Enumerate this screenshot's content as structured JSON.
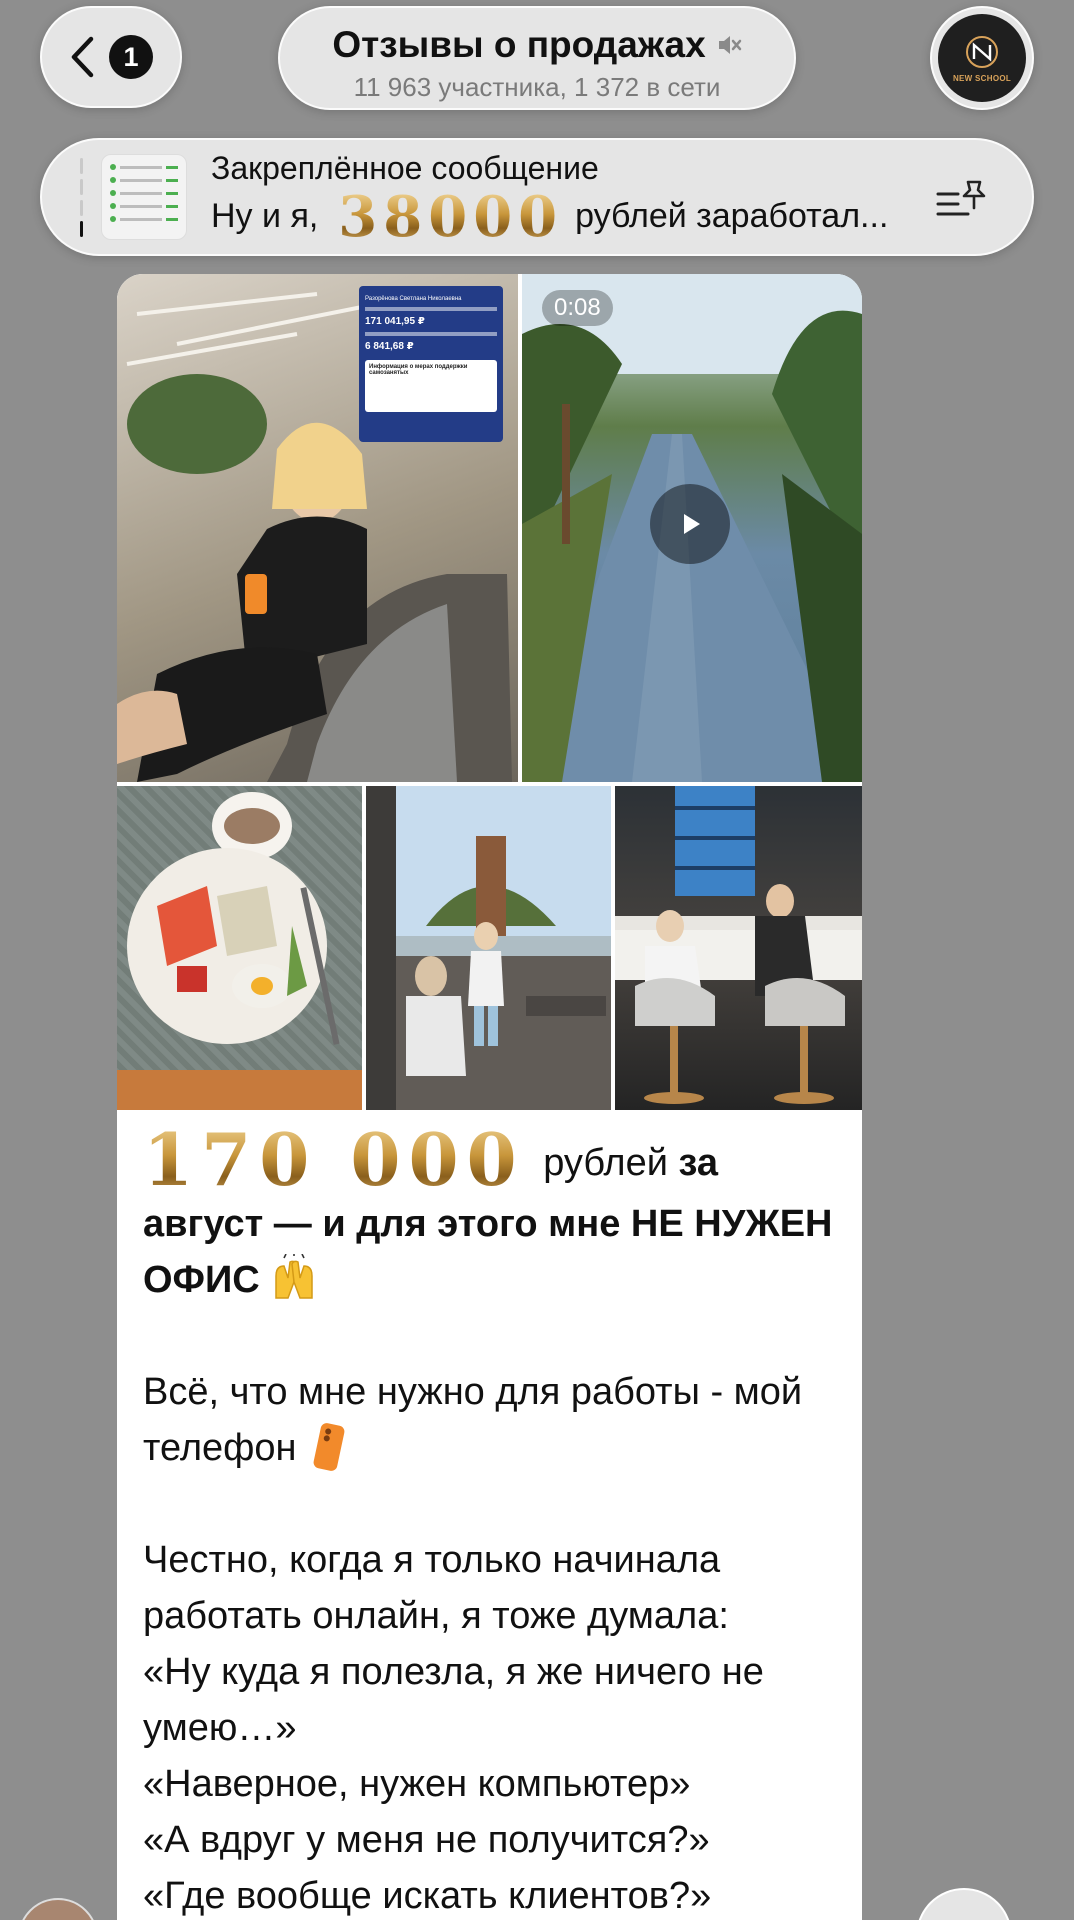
{
  "header": {
    "unread_count": "1",
    "title": "Отзывы о продажах",
    "subtitle": "11 963 участника, 1 372 в сети",
    "avatar_text": "NEW SCHOOL"
  },
  "pinned": {
    "label": "Закреплённое сообщение",
    "prefix": "Ну и я,",
    "amount": "38000",
    "suffix": "рублей заработал..."
  },
  "message": {
    "video_duration": "0:08",
    "card": {
      "name": "Разорёнова Светлана Николаевна",
      "amount1": "171 041,95 ₽",
      "amount2": "6 841,68 ₽",
      "info": "Информация о мерах поддержки самозанятых"
    },
    "amount_big": "170 000",
    "headline_normal": "рублей",
    "headline_bold": "за август — и для этого мне НЕ НУЖЕН ОФИС",
    "para1": "Всё, что мне нужно для работы - мой телефон",
    "para2": [
      "Честно, когда я только начинала работать онлайн, я тоже думала:",
      "«Ну куда я полезла, я же ничего не умею…»",
      "«Наверное, нужен компьютер»",
      "«А вдруг у меня не получится?»",
      "«Где вообще искать клиентов?»"
    ]
  },
  "icons": {
    "back": "chevron-left-icon",
    "mute": "muted-speaker-icon",
    "pinned_list": "pinned-list-icon",
    "play": "play-icon",
    "hands": "raising-hands-emoji",
    "phone": "mobile-phone-emoji"
  },
  "colors": {
    "gold": "#c8963b",
    "accent_text": "#111111",
    "background": "#8e8e8e"
  }
}
